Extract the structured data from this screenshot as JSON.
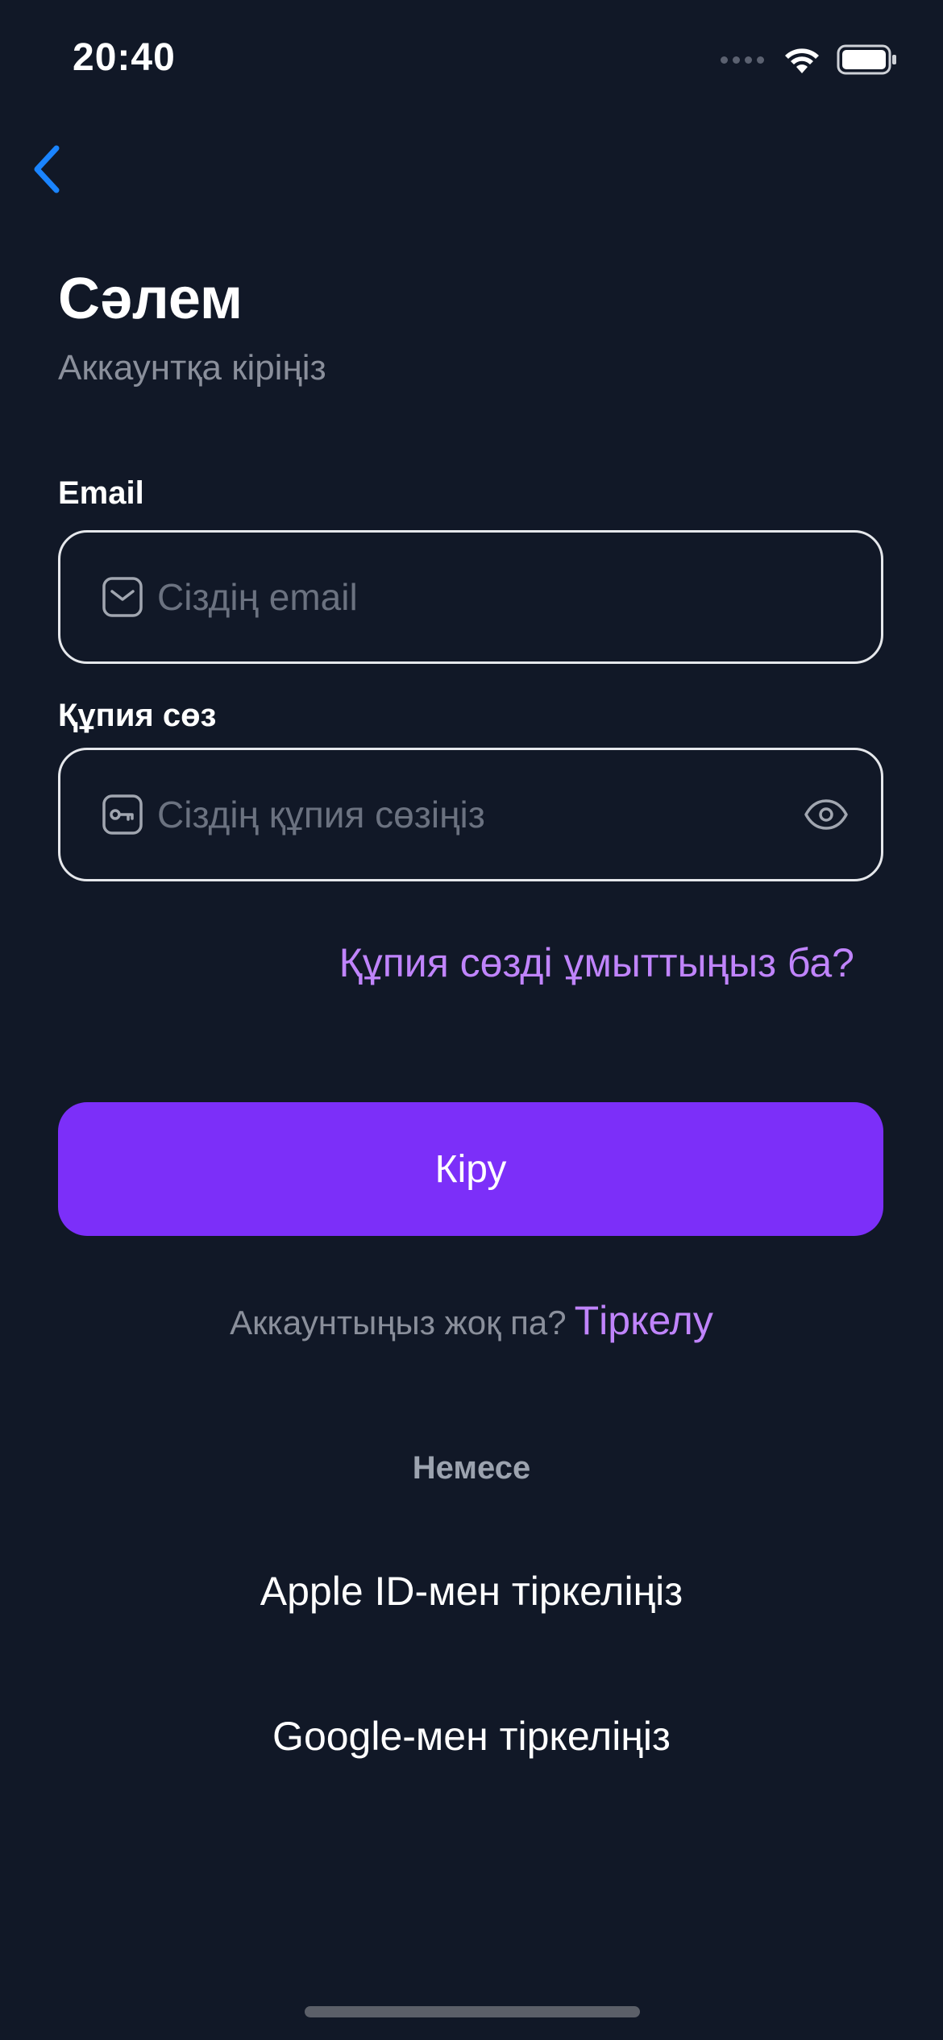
{
  "status_bar": {
    "time": "20:40"
  },
  "nav": {
    "back_icon": "chevron-left-icon",
    "accent_color": "#1a84ff"
  },
  "header": {
    "title": "Сәлем",
    "subtitle": "Аккаунтқа кіріңіз"
  },
  "form": {
    "email": {
      "label": "Email",
      "placeholder": "Сіздің email",
      "value": "",
      "icon": "mail-icon"
    },
    "password": {
      "label": "Құпия сөз",
      "placeholder": "Сіздің құпия сөзіңіз",
      "value": "",
      "icon": "key-icon",
      "toggle_icon": "eye-icon"
    },
    "forgot_label": "Құпия сөзді ұмыттыңыз ба?",
    "submit_label": "Кіру"
  },
  "signup": {
    "prompt": "Аккаунтыңыз жоқ па?",
    "link_label": "Тіркелу"
  },
  "alternatives": {
    "divider_label": "Немесе",
    "apple_label": "Apple ID-мен тіркеліңіз",
    "google_label": "Google-мен тіркеліңіз"
  },
  "colors": {
    "background": "#111827",
    "primary": "#7c2ff9",
    "link": "#c084fc",
    "muted": "#8a8f9b"
  }
}
